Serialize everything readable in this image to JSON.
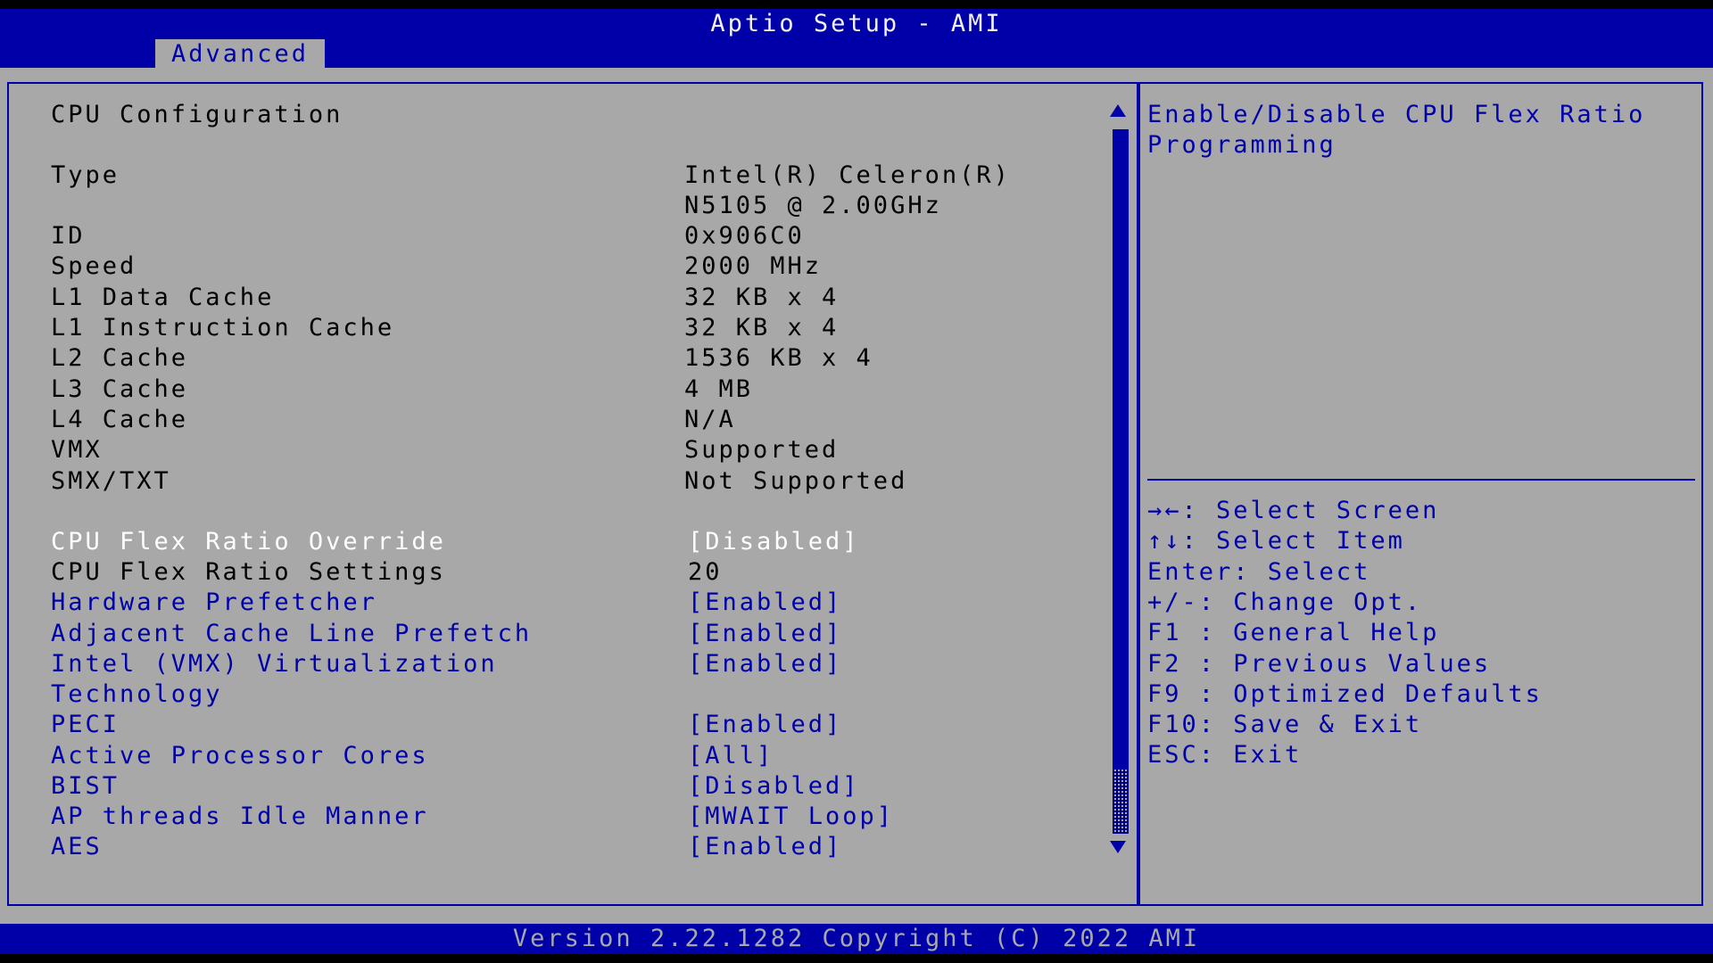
{
  "app": {
    "title": "Aptio Setup - AMI",
    "active_tab": "Advanced",
    "footer": "Version 2.22.1282 Copyright (C) 2022 AMI"
  },
  "colors": {
    "bar_blue": "#0000a8",
    "panel_gray": "#a8a8a8",
    "selected_text": "#ffffff"
  },
  "page": {
    "heading": "CPU Configuration",
    "info": [
      {
        "label": "Type",
        "value": "Intel(R) Celeron(R)",
        "value2": "N5105 @ 2.00GHz"
      },
      {
        "label": "ID",
        "value": "0x906C0"
      },
      {
        "label": "Speed",
        "value": "2000 MHz"
      },
      {
        "label": "L1 Data Cache",
        "value": "32 KB x 4"
      },
      {
        "label": "L1 Instruction Cache",
        "value": "32 KB x 4"
      },
      {
        "label": "L2 Cache",
        "value": "1536 KB x 4"
      },
      {
        "label": "L3 Cache",
        "value": "4 MB"
      },
      {
        "label": "L4 Cache",
        "value": "N/A"
      },
      {
        "label": "VMX",
        "value": "Supported"
      },
      {
        "label": "SMX/TXT",
        "value": "Not Supported"
      }
    ],
    "options": [
      {
        "label": "CPU Flex Ratio Override",
        "value": "[Disabled]",
        "selected": true
      },
      {
        "label": "CPU Flex Ratio Settings",
        "value": "20",
        "readonly": true
      },
      {
        "label": "Hardware Prefetcher",
        "value": "[Enabled]"
      },
      {
        "label": "Adjacent Cache Line Prefetch",
        "value": "[Enabled]"
      },
      {
        "label": "Intel (VMX) Virtualization",
        "label2": "Technology",
        "value": "[Enabled]"
      },
      {
        "label": "PECI",
        "value": "[Enabled]"
      },
      {
        "label": "Active Processor Cores",
        "value": "[All]"
      },
      {
        "label": "BIST",
        "value": "[Disabled]"
      },
      {
        "label": "AP threads Idle Manner",
        "value": "[MWAIT Loop]"
      },
      {
        "label": "AES",
        "value": "[Enabled]"
      }
    ]
  },
  "help": {
    "description": "Enable/Disable CPU Flex Ratio\nProgramming",
    "keys": [
      "→←: Select Screen",
      "↑↓: Select Item",
      "Enter: Select",
      "+/-: Change Opt.",
      "F1 : General Help",
      "F2 : Previous Values",
      "F9 : Optimized Defaults",
      "F10: Save & Exit",
      "ESC: Exit"
    ]
  }
}
